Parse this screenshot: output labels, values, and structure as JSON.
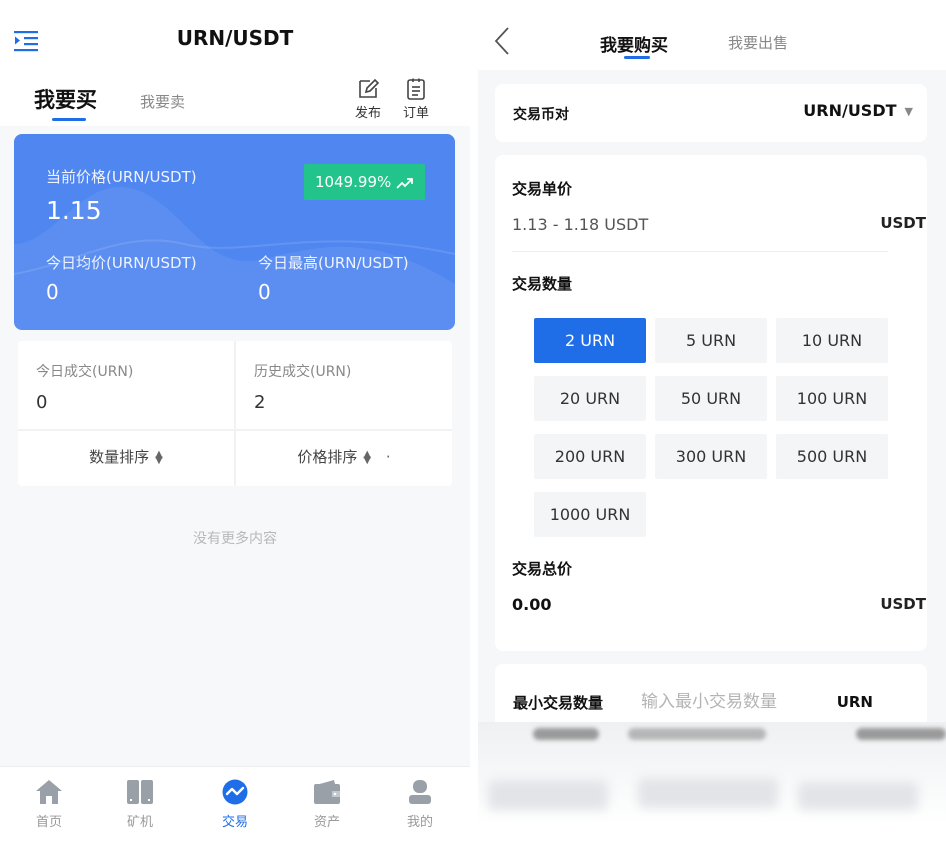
{
  "left": {
    "header": {
      "title": "URN/USDT",
      "menu_icon": "menu-indent-icon"
    },
    "tabs": {
      "buy": "我要买",
      "sell": "我要卖"
    },
    "tools": {
      "publish": "发布",
      "orders": "订单"
    },
    "price_card": {
      "current_label": "当前价格(URN/USDT)",
      "current_value": "1.15",
      "change_pct": "1049.99%",
      "avg_label": "今日均价(URN/USDT)",
      "avg_value": "0",
      "high_label": "今日最高(URN/USDT)",
      "high_value": "0",
      "bg_color": "#4f86ef",
      "badge_color": "#22c48b"
    },
    "stats": {
      "today_label": "今日成交(URN)",
      "today_value": "0",
      "history_label": "历史成交(URN)",
      "history_value": "2",
      "sort_qty": "数量排序",
      "sort_price": "价格排序",
      "sort_price_dot": "·"
    },
    "empty_text": "没有更多内容",
    "nav": [
      {
        "label": "首页",
        "icon": "home-icon"
      },
      {
        "label": "矿机",
        "icon": "miner-icon"
      },
      {
        "label": "交易",
        "icon": "trade-icon",
        "active": true
      },
      {
        "label": "资产",
        "icon": "wallet-icon"
      },
      {
        "label": "我的",
        "icon": "user-icon"
      }
    ],
    "accent_color": "#1f6ee8"
  },
  "right": {
    "header": {
      "buy_tab": "我要购买",
      "sell_tab": "我要出售",
      "back_icon": "chevron-left-icon"
    },
    "pair": {
      "label": "交易币对",
      "value": "URN/USDT"
    },
    "unit_price": {
      "label": "交易单价",
      "range": "1.13 - 1.18 USDT",
      "unit": "USDT"
    },
    "quantity": {
      "label": "交易数量",
      "options": [
        "2 URN",
        "5 URN",
        "10 URN",
        "20 URN",
        "50 URN",
        "100 URN",
        "200 URN",
        "300 URN",
        "500 URN",
        "1000 URN"
      ],
      "selected": "2 URN"
    },
    "total": {
      "label": "交易总价",
      "value": "0.00",
      "unit": "USDT"
    },
    "min_qty": {
      "label": "最小交易数量",
      "placeholder": "输入最小交易数量",
      "unit": "URN"
    }
  }
}
